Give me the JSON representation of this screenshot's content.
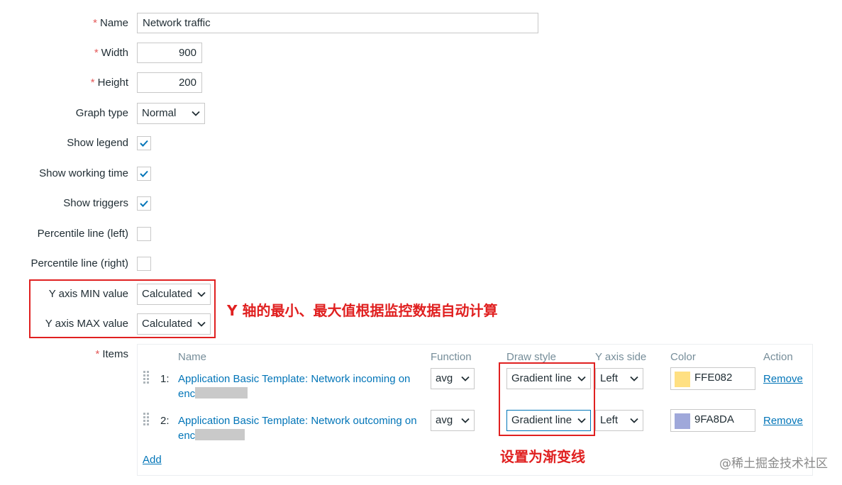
{
  "form": {
    "required_mark": "*",
    "name": {
      "label": "Name",
      "value": "Network traffic"
    },
    "width": {
      "label": "Width",
      "value": "900"
    },
    "height": {
      "label": "Height",
      "value": "200"
    },
    "graph_type": {
      "label": "Graph type",
      "value": "Normal"
    },
    "show_legend": {
      "label": "Show legend",
      "checked": true
    },
    "show_working_time": {
      "label": "Show working time",
      "checked": true
    },
    "show_triggers": {
      "label": "Show triggers",
      "checked": true
    },
    "percentile_left": {
      "label": "Percentile line (left)",
      "checked": false
    },
    "percentile_right": {
      "label": "Percentile line (right)",
      "checked": false
    },
    "y_min": {
      "label": "Y axis MIN value",
      "value": "Calculated"
    },
    "y_max": {
      "label": "Y axis MAX value",
      "value": "Calculated"
    },
    "items_label": "Items"
  },
  "items": {
    "headers": {
      "name": "Name",
      "function": "Function",
      "draw_style": "Draw style",
      "y_axis_side": "Y axis side",
      "color": "Color",
      "action": "Action"
    },
    "rows": [
      {
        "index": "1:",
        "name_line1": "Application Basic Template: Network incoming on",
        "name_line2": "enc",
        "function": "avg",
        "draw_style": "Gradient line",
        "y_axis_side": "Left",
        "color": "FFE082",
        "swatch": "#FFE082",
        "action": "Remove"
      },
      {
        "index": "2:",
        "name_line1": "Application Basic Template: Network outcoming on",
        "name_line2": "enc",
        "function": "avg",
        "draw_style": "Gradient line",
        "y_axis_side": "Left",
        "color": "9FA8DA",
        "swatch": "#9FA8DA",
        "action": "Remove"
      }
    ],
    "add_label": "Add"
  },
  "annotations": {
    "y_axis_note": "Y 轴的最小、最大值根据监控数据自动计算",
    "draw_style_note": "设置为渐变线"
  },
  "watermark": "@稀土掘金技术社区",
  "colors": {
    "link": "#0275b8",
    "required": "#e45959",
    "check": "#0275b8",
    "annotation": "#e02020"
  }
}
